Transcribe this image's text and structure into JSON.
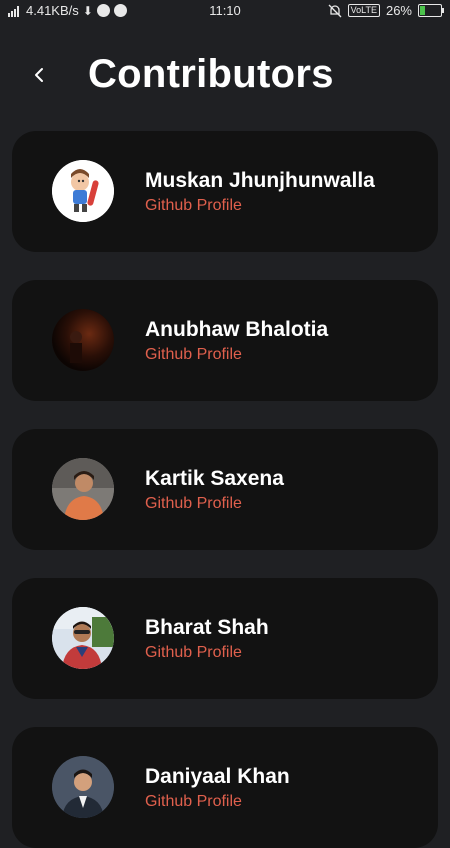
{
  "status_bar": {
    "speed": "4.41KB/s",
    "time": "11:10",
    "network_badge": "VoLTE",
    "battery": "26%",
    "battery_level": 0.26,
    "icons": [
      "signal-icon",
      "download-icon",
      "message-icon",
      "chat-icon",
      "bell-muted-icon",
      "battery-charging-icon"
    ]
  },
  "header": {
    "back_icon": "chevron-left-icon",
    "title": "Contributors"
  },
  "contributors": [
    {
      "name": "Muskan Jhunjhunwalla",
      "link": "Github Profile",
      "avatar": "cartoon-skateboarder"
    },
    {
      "name": "Anubhaw Bhalotia",
      "link": "Github Profile",
      "avatar": "dark-photo"
    },
    {
      "name": "Kartik Saxena",
      "link": "Github Profile",
      "avatar": "person-photo"
    },
    {
      "name": "Bharat Shah",
      "link": "Github Profile",
      "avatar": "person-photo"
    },
    {
      "name": "Daniyaal Khan",
      "link": "Github Profile",
      "avatar": "person-photo"
    }
  ],
  "colors": {
    "background": "#1f2023",
    "card": "#121212",
    "link": "#e0604d"
  }
}
